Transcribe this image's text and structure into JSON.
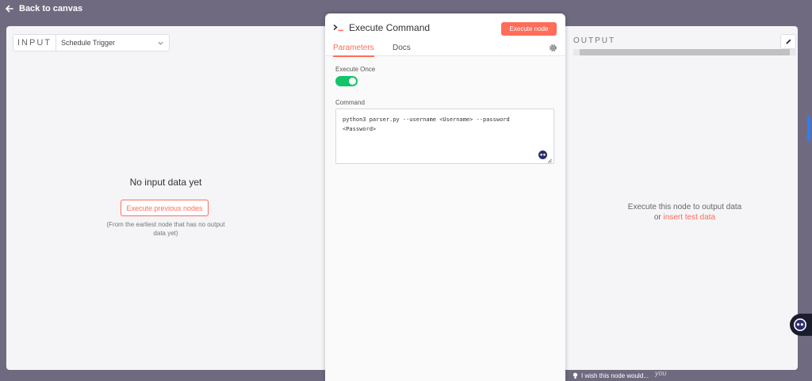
{
  "topbar": {
    "back_label": "Back to canvas"
  },
  "input_panel": {
    "label": "INPUT",
    "selected_node": "Schedule Trigger",
    "empty_title": "No input data yet",
    "execute_previous_label": "Execute previous nodes",
    "hint": "(From the earliest node that has no output data yet)"
  },
  "node": {
    "title": "Execute Command",
    "execute_label": "Execute node",
    "tabs": [
      {
        "label": "Parameters"
      },
      {
        "label": "Docs"
      }
    ],
    "execute_once_label": "Execute Once",
    "execute_once_value": "on",
    "command_label": "Command",
    "command_value": "python3 parser.py --username <Username> --password\n<Password>"
  },
  "output_panel": {
    "label": "OUTPUT",
    "message_line1": "Execute this node to output data",
    "message_or": "or ",
    "insert_link": "insert test data"
  },
  "footer": {
    "wish_text": "I wish this node would...",
    "you_text": "you"
  },
  "colors": {
    "accent": "#ff6d5a",
    "toggle_on": "#13c46b",
    "backdrop": "#6f6a80"
  }
}
